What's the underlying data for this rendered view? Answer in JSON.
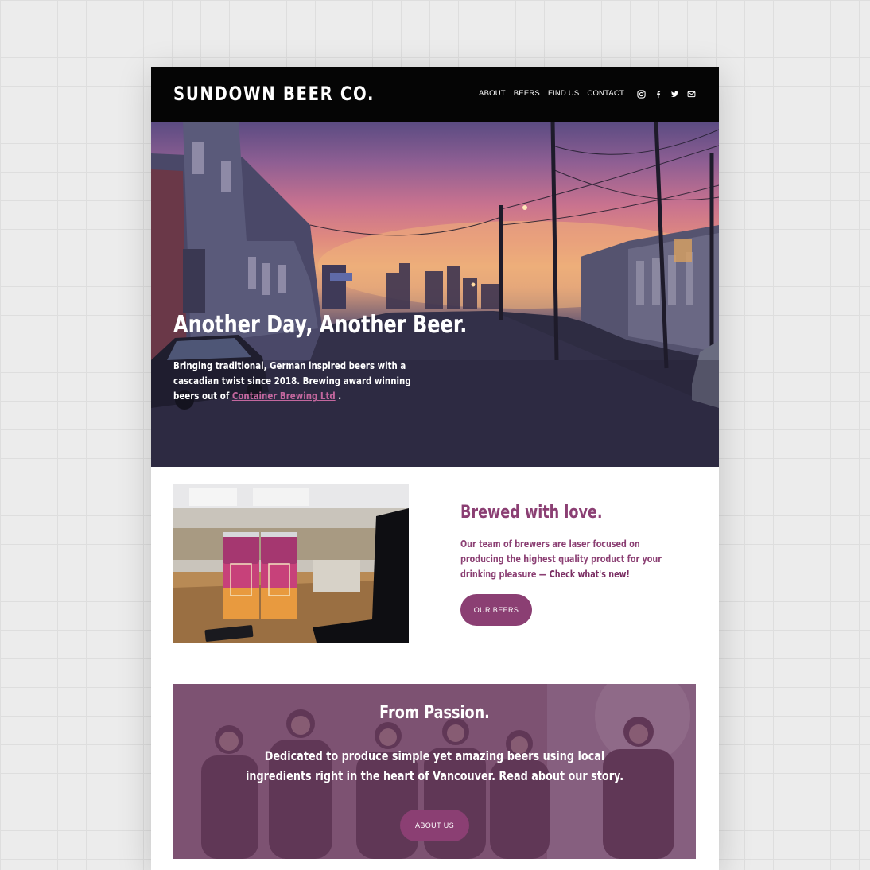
{
  "header": {
    "logo": "SUNDOWN BEER CO.",
    "nav": [
      "ABOUT",
      "BEERS",
      "FIND US",
      "CONTACT"
    ],
    "social_icons": [
      "instagram-icon",
      "facebook-icon",
      "twitter-icon",
      "email-icon"
    ]
  },
  "hero": {
    "title": "Another Day, Another Beer.",
    "text_before_link": "Bringing traditional, German inspired beers with a cascadian twist since 2018. Brewing award winning beers out of ",
    "link_text": "Container Brewing Ltd",
    "text_after_link": " ."
  },
  "brewed": {
    "title": "Brewed with love.",
    "text": "Our team of brewers are laser focused on producing the highest quality product for your drinking pleasure — ",
    "link_text": "Check what's new!",
    "button": "OUR BEERS"
  },
  "passion": {
    "title": "From Passion.",
    "text": "Dedicated to produce simple yet amazing beers using local ingredients right in the heart of Vancouver. Read about our story.",
    "button": "ABOUT US"
  },
  "colors": {
    "accent": "#8b3f73",
    "header_bg": "#050505"
  }
}
